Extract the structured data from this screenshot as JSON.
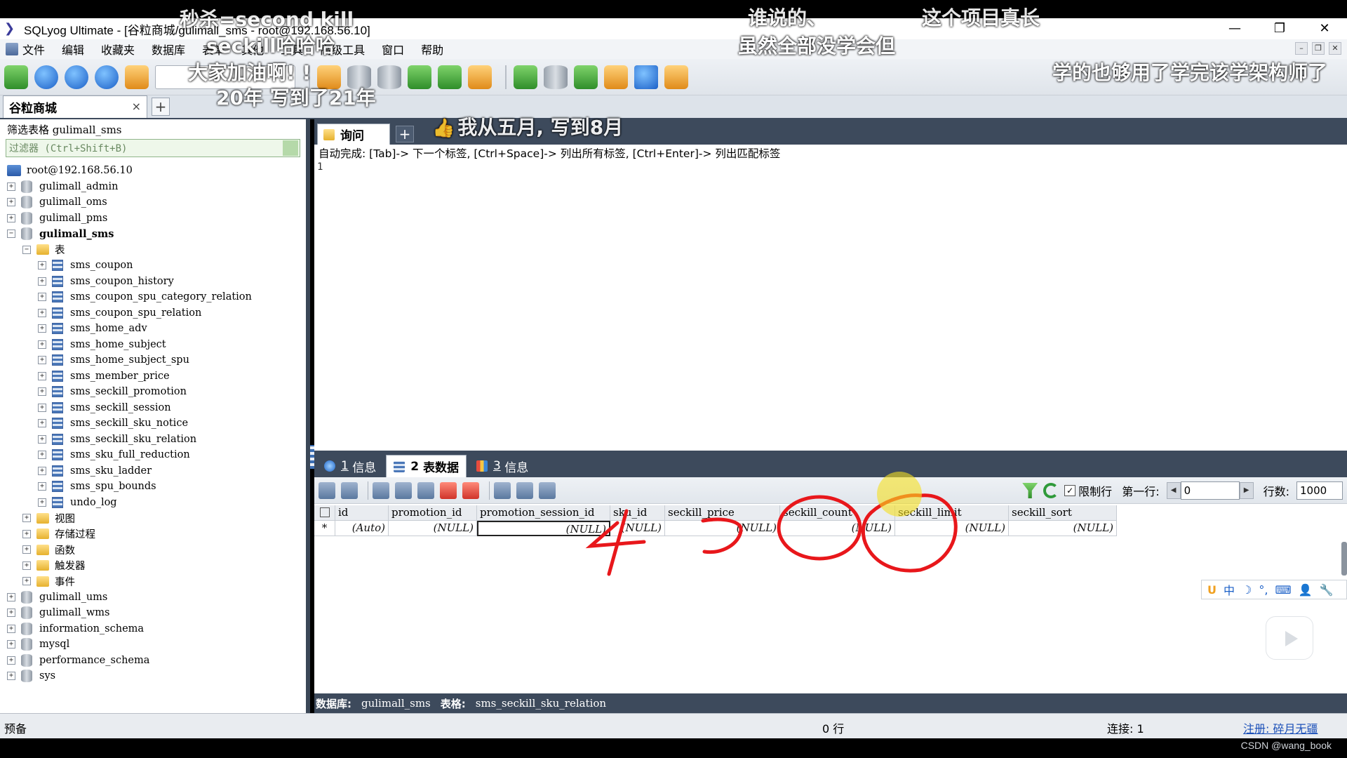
{
  "window": {
    "title": "SQLyog Ultimate - [谷粒商城/gulimall_sms - root@192.168.56.10]",
    "controls": [
      "—",
      "❐",
      "✕"
    ]
  },
  "menu": [
    "文件",
    "编辑",
    "收藏夹",
    "数据库",
    "表单",
    "其他",
    "工具",
    "高级工具",
    "窗口",
    "帮助"
  ],
  "connection_tab": {
    "label": "谷粒商城",
    "close": "×",
    "add": "+"
  },
  "left": {
    "filter_label": "筛选表格 gulimall_sms",
    "filter_placeholder": "过滤器 (Ctrl+Shift+B)",
    "server": "root@192.168.56.10",
    "dbs_top": [
      "gulimall_admin",
      "gulimall_oms",
      "gulimall_pms"
    ],
    "open_db": "gulimall_sms",
    "tables_folder": "表",
    "tables": [
      "sms_coupon",
      "sms_coupon_history",
      "sms_coupon_spu_category_relation",
      "sms_coupon_spu_relation",
      "sms_home_adv",
      "sms_home_subject",
      "sms_home_subject_spu",
      "sms_member_price",
      "sms_seckill_promotion",
      "sms_seckill_session",
      "sms_seckill_sku_notice",
      "sms_seckill_sku_relation",
      "sms_sku_full_reduction",
      "sms_sku_ladder",
      "sms_spu_bounds",
      "undo_log"
    ],
    "folders": [
      "视图",
      "存储过程",
      "函数",
      "触发器",
      "事件"
    ],
    "dbs_bottom": [
      "gulimall_ums",
      "gulimall_wms",
      "information_schema",
      "mysql",
      "performance_schema",
      "sys"
    ]
  },
  "query": {
    "tab_label": "询问",
    "add": "+",
    "autocomplete_hint": "自动完成: [Tab]-> 下一个标签, [Ctrl+Space]-> 列出所有标签, [Ctrl+Enter]-> 列出匹配标签",
    "line_number": "1"
  },
  "result_tabs": [
    {
      "num": "1",
      "label": "信息"
    },
    {
      "num": "2",
      "label": "表数据"
    },
    {
      "num": "3",
      "label": "信息"
    }
  ],
  "result_toolbar": {
    "limit_label": "限制行",
    "limit_checked": "✓",
    "first_row_label": "第一行:",
    "first_row_value": "0",
    "rows_label": "行数:",
    "rows_value": "1000"
  },
  "grid": {
    "columns": [
      "id",
      "promotion_id",
      "promotion_session_id",
      "sku_id",
      "seckill_price",
      "seckill_count",
      "seckill_limit",
      "seckill_sort"
    ],
    "new_row_marker": "*",
    "new_row": [
      "(Auto)",
      "(NULL)",
      "(NULL)",
      "(NULL)",
      "(NULL)",
      "(NULL)",
      "(NULL)",
      "(NULL)"
    ]
  },
  "inner_status": {
    "db_label": "数据库:",
    "db_value": "gulimall_sms",
    "table_label": "表格:",
    "table_value": "sms_seckill_sku_relation"
  },
  "statusbar": {
    "left": "预备",
    "rows": "0 行",
    "connections": "连接: 1",
    "register": "注册: 碎月无疆"
  },
  "watermark": "CSDN @wang_book",
  "danmaku": [
    "秒杀=second kill",
    "seckill哈哈哈",
    "大家加油啊! !",
    "20年  写到了21年",
    "谁说的、",
    "虽然全部没学会但",
    "这个项目真长",
    "学的也够用了学完该学架构师了",
    "我从五月, 写到8月"
  ],
  "annotations": {
    "written_number": "4",
    "color": "#e8171b"
  },
  "ime": [
    "中",
    "☽",
    "°,",
    "⌨",
    "👤",
    "🔧"
  ],
  "colors": {
    "panel_dark": "#3d4a5c",
    "accent_blue": "#1a5fc7",
    "annotation_red": "#e8171b"
  }
}
